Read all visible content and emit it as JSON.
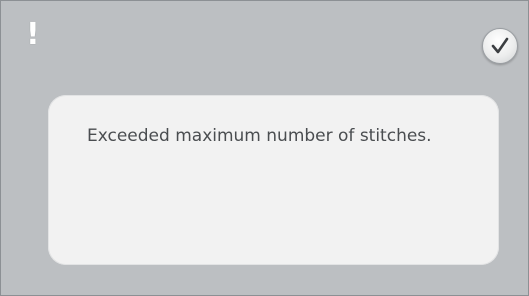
{
  "alert": {
    "icon": "exclamation-icon",
    "glyph": "!"
  },
  "ok_button": {
    "icon": "checkmark-icon"
  },
  "message": {
    "text": "Exceeded maximum number of stitches."
  },
  "colors": {
    "background": "#bcbfc2",
    "panel": "#f2f2f2",
    "text": "#4a4d50"
  }
}
